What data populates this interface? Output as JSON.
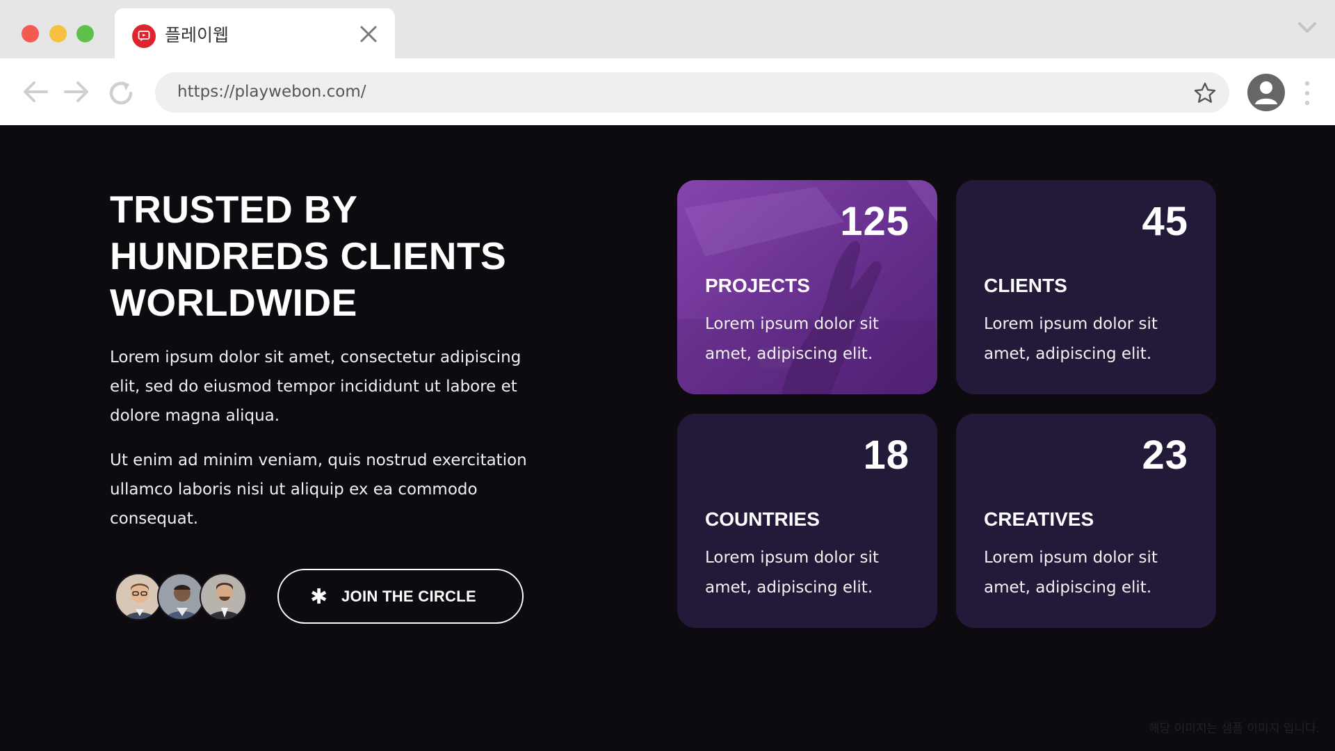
{
  "browser": {
    "tab": {
      "title": "플레이웹",
      "favicon": "playweb-logo-icon"
    },
    "url": "https://playwebon.com/",
    "icons": {
      "back": "arrow-left-icon",
      "forward": "arrow-right-icon",
      "reload": "reload-icon",
      "bookmark": "star-icon",
      "profile": "profile-icon",
      "menu": "more-vertical-icon",
      "tab_close": "close-icon",
      "tab_list": "chevron-down-icon"
    }
  },
  "hero": {
    "headline_lines": [
      "TRUSTED BY",
      "HUNDREDS CLIENTS",
      "WORLDWIDE"
    ],
    "paragraph_1": "Lorem ipsum dolor sit amet, consectetur adipiscing elit, sed do eiusmod tempor incididunt ut labore et dolore magna aliqua.",
    "paragraph_2": "Ut enim ad minim veniam, quis nostrud exercitation ullamco laboris nisi ut aliquip ex ea commodo consequat.",
    "cta_label": "JOIN THE CIRCLE",
    "cta_icon": "asterisk-icon"
  },
  "stats": [
    {
      "number": "125",
      "label": "PROJECTS",
      "text": "Lorem ipsum dolor sit amet, adipiscing elit."
    },
    {
      "number": "45",
      "label": "CLIENTS",
      "text": "Lorem ipsum dolor sit amet, adipiscing elit."
    },
    {
      "number": "18",
      "label": "COUNTRIES",
      "text": "Lorem ipsum dolor sit amet, adipiscing elit."
    },
    {
      "number": "23",
      "label": "CREATIVES",
      "text": "Lorem ipsum dolor sit amet, adipiscing elit."
    }
  ],
  "footer_note": "해당 이미지는 샘플 이미지 입니다.",
  "colors": {
    "page_bg": "#0d0b10",
    "card_bg": "#231a3a",
    "card_highlight": "#7c3ea6",
    "text": "#ffffff"
  }
}
